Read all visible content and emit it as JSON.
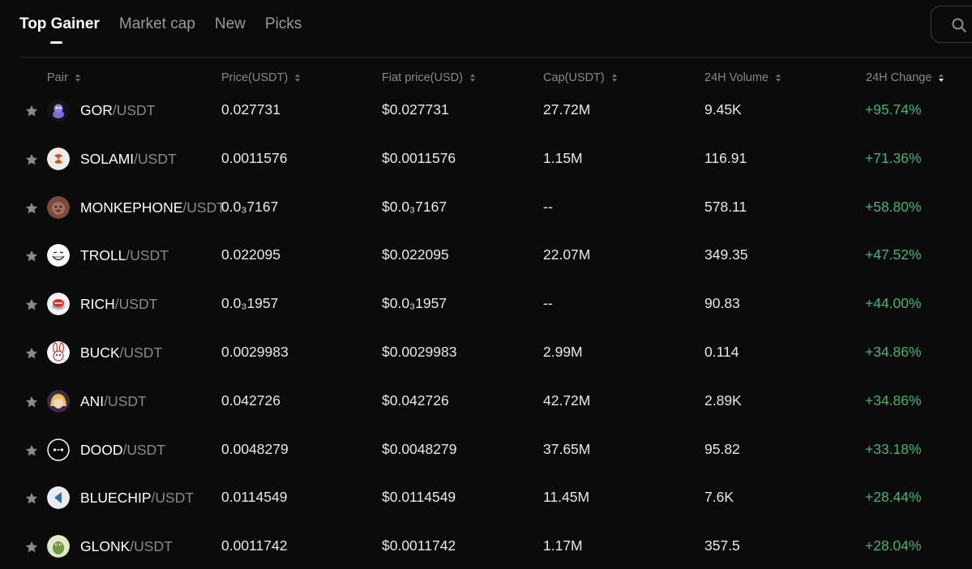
{
  "tabs": [
    {
      "label": "Top Gainer",
      "active": true
    },
    {
      "label": "Market cap",
      "active": false
    },
    {
      "label": "New",
      "active": false
    },
    {
      "label": "Picks",
      "active": false
    }
  ],
  "columns": {
    "pair": "Pair",
    "price": "Price(USDT)",
    "fiat": "Fiat price(USD)",
    "cap": "Cap(USDT)",
    "volume": "24H Volume",
    "change": "24H Change"
  },
  "rows": [
    {
      "base": "GOR",
      "quote": "/USDT",
      "price": "0.027731",
      "fiat": "$0.027731",
      "cap": "27.72M",
      "volume": "9.45K",
      "change": "+95.74%"
    },
    {
      "base": "SOLAMI",
      "quote": "/USDT",
      "price": "0.0011576",
      "fiat": "$0.0011576",
      "cap": "1.15M",
      "volume": "116.91",
      "change": "+71.36%"
    },
    {
      "base": "MONKEPHONE",
      "quote": "/USDT",
      "price": "0.0₃7167",
      "fiat": "$0.0₃7167",
      "cap": "--",
      "volume": "578.11",
      "change": "+58.80%"
    },
    {
      "base": "TROLL",
      "quote": "/USDT",
      "price": "0.022095",
      "fiat": "$0.022095",
      "cap": "22.07M",
      "volume": "349.35",
      "change": "+47.52%"
    },
    {
      "base": "RICH",
      "quote": "/USDT",
      "price": "0.0₃1957",
      "fiat": "$0.0₃1957",
      "cap": "--",
      "volume": "90.83",
      "change": "+44.00%"
    },
    {
      "base": "BUCK",
      "quote": "/USDT",
      "price": "0.0029983",
      "fiat": "$0.0029983",
      "cap": "2.99M",
      "volume": "0.114",
      "change": "+34.86%"
    },
    {
      "base": "ANI",
      "quote": "/USDT",
      "price": "0.042726",
      "fiat": "$0.042726",
      "cap": "42.72M",
      "volume": "2.89K",
      "change": "+34.86%"
    },
    {
      "base": "DOOD",
      "quote": "/USDT",
      "price": "0.0048279",
      "fiat": "$0.0048279",
      "cap": "37.65M",
      "volume": "95.82",
      "change": "+33.18%"
    },
    {
      "base": "BLUECHIP",
      "quote": "/USDT",
      "price": "0.0114549",
      "fiat": "$0.0114549",
      "cap": "11.45M",
      "volume": "7.6K",
      "change": "+28.44%"
    },
    {
      "base": "GLONK",
      "quote": "/USDT",
      "price": "0.0011742",
      "fiat": "$0.0011742",
      "cap": "1.17M",
      "volume": "357.5",
      "change": "+28.04%"
    }
  ],
  "colors": {
    "background": "#0b0b0b",
    "positive": "#3fb57a",
    "muted": "#888888"
  },
  "icons": [
    "search-icon",
    "star-icon",
    "sort-icon"
  ]
}
